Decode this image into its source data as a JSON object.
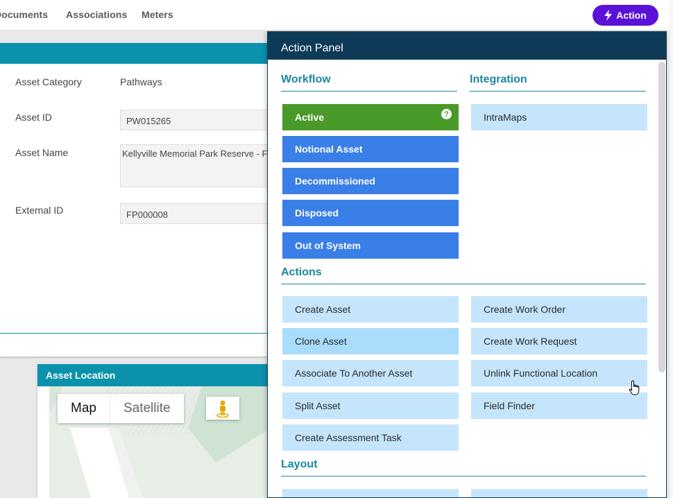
{
  "nav": {
    "tabs": [
      "Documents",
      "Associations",
      "Meters"
    ],
    "action_label": "Action",
    "action_color": "#5a12d8"
  },
  "asset": {
    "fields": [
      {
        "label": "Asset Category",
        "value": "Pathways"
      },
      {
        "label": "Asset ID",
        "value": "PW015265"
      },
      {
        "label": "Asset Name",
        "value": "Kellyville Memorial Park Reserve - F"
      },
      {
        "label": "External ID",
        "value": "FP000008"
      }
    ]
  },
  "location": {
    "title": "Asset Location",
    "map_label": "Map",
    "satellite_label": "Satellite",
    "pegman_icon": "street-view-pegman-icon"
  },
  "panel": {
    "title": "Action Panel",
    "workflow": {
      "title": "Workflow",
      "items": [
        "Active",
        "Notional Asset",
        "Decommissioned",
        "Disposed",
        "Out of System"
      ],
      "active_color": "#4a9a2a",
      "status_color": "#3a7ee8"
    },
    "integration": {
      "title": "Integration",
      "items": [
        "IntraMaps"
      ]
    },
    "actions": {
      "title": "Actions",
      "left": [
        "Create Asset",
        "Clone Asset",
        "Associate To Another Asset",
        "Split Asset",
        "Create Assessment Task"
      ],
      "right": [
        "Create Work Order",
        "Create Work Request",
        "Unlink Functional Location",
        "Field Finder"
      ]
    },
    "layout": {
      "title": "Layout"
    },
    "header_color": "#0d3b57",
    "accent_color": "#1a86a4"
  }
}
